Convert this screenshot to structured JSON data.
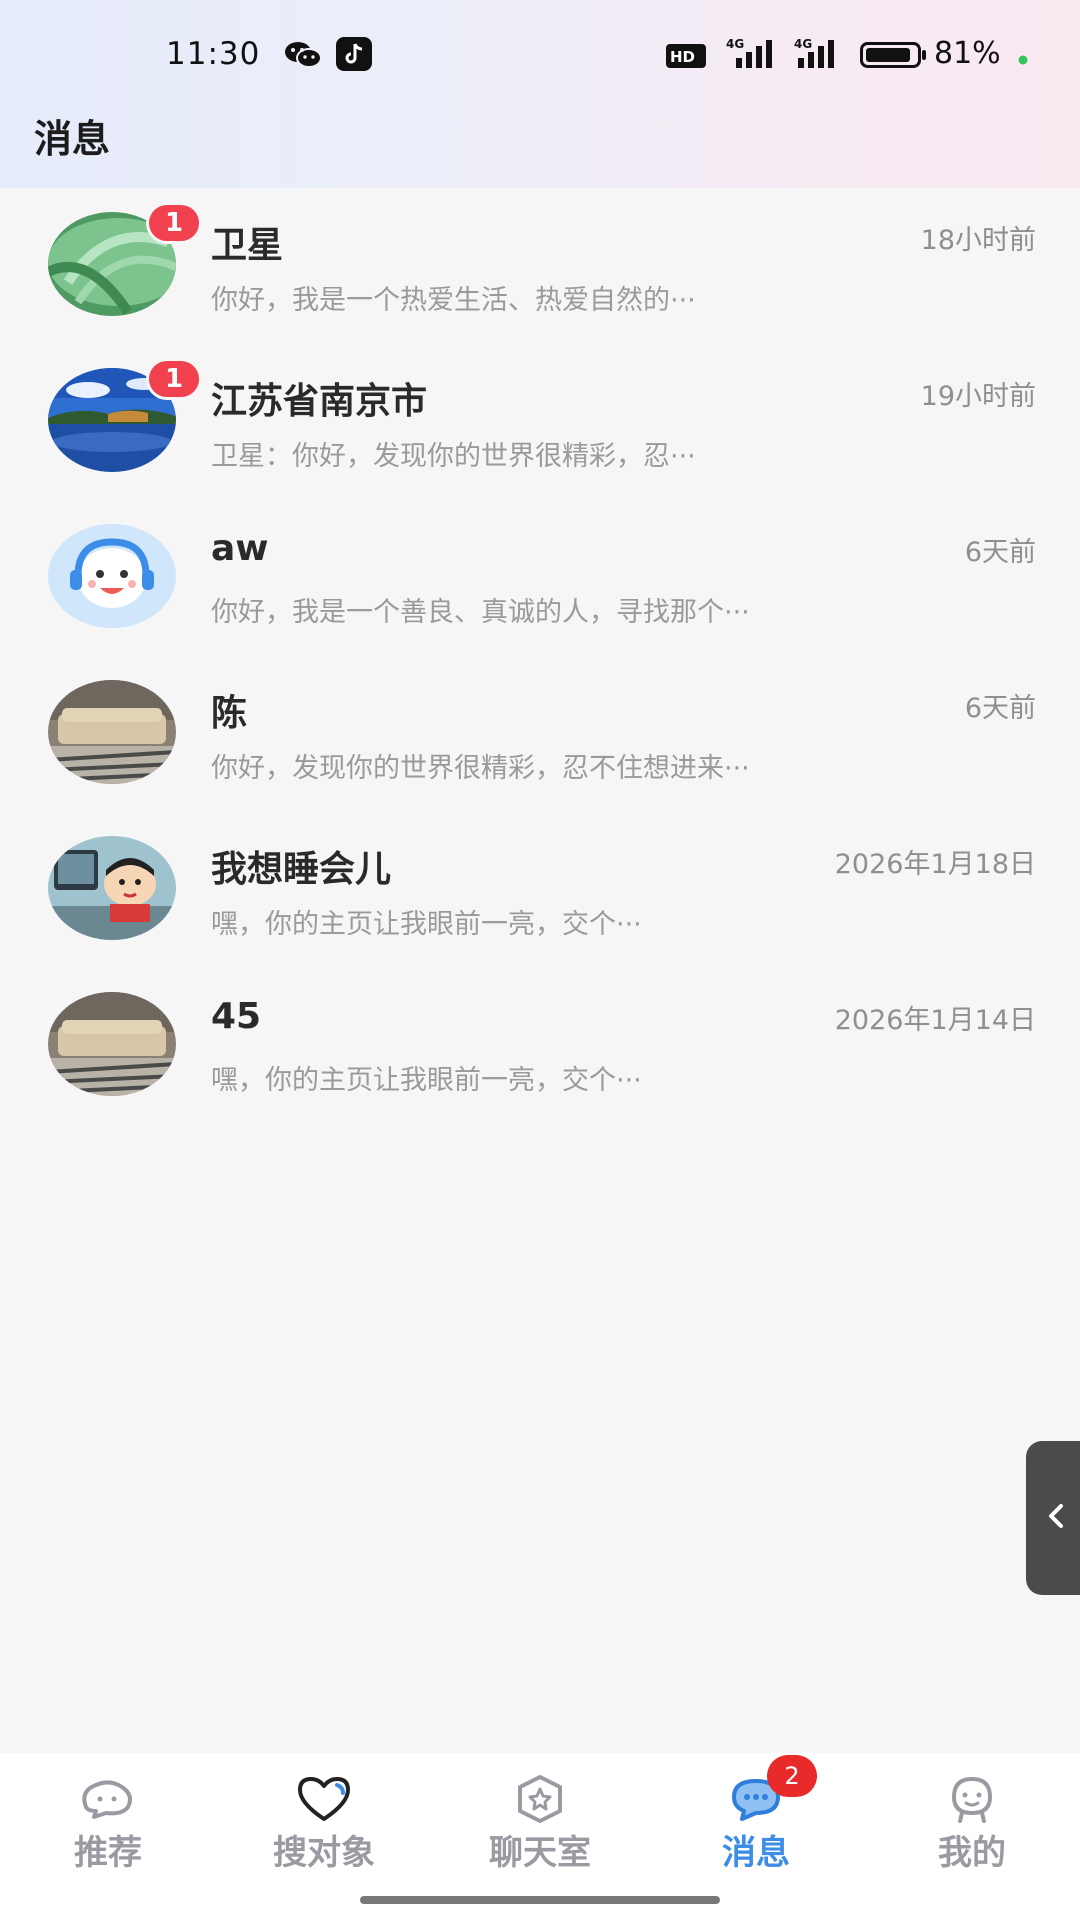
{
  "status_bar": {
    "time": "11:30",
    "battery_text": "81%",
    "icons": [
      "wechat-icon",
      "tiktok-icon",
      "hd-icon",
      "signal-4g-icon",
      "signal-4g-icon",
      "battery-icon"
    ],
    "dot_color": "#36c55a"
  },
  "header": {
    "title": "消息"
  },
  "conversations": [
    {
      "name": "卫星",
      "time": "18小时前",
      "preview": "你好，我是一个热爱生活、热爱自然的···",
      "badge": "1"
    },
    {
      "name": "江苏省南京市",
      "time": "19小时前",
      "preview": "卫星：你好，发现你的世界很精彩，忍···",
      "badge": "1"
    },
    {
      "name": "aw",
      "time": "6天前",
      "preview": "你好，我是一个善良、真诚的人，寻找那个···",
      "badge": ""
    },
    {
      "name": "陈",
      "time": "6天前",
      "preview": "你好，发现你的世界很精彩，忍不住想进来···",
      "badge": ""
    },
    {
      "name": "我想睡会儿",
      "time": "2026年1月18日",
      "preview": "嘿，你的主页让我眼前一亮，交个···",
      "badge": ""
    },
    {
      "name": "45",
      "time": "2026年1月14日",
      "preview": "嘿，你的主页让我眼前一亮，交个···",
      "badge": ""
    }
  ],
  "nav": {
    "items": [
      {
        "label": "推荐",
        "icon": "chat-bubble-icon"
      },
      {
        "label": "搜对象",
        "icon": "heart-icon"
      },
      {
        "label": "聊天室",
        "icon": "star-hexagon-icon"
      },
      {
        "label": "消息",
        "icon": "message-icon",
        "active": true
      },
      {
        "label": "我的",
        "icon": "profile-icon"
      }
    ],
    "badge": "2",
    "active_color": "#3d8de6"
  }
}
